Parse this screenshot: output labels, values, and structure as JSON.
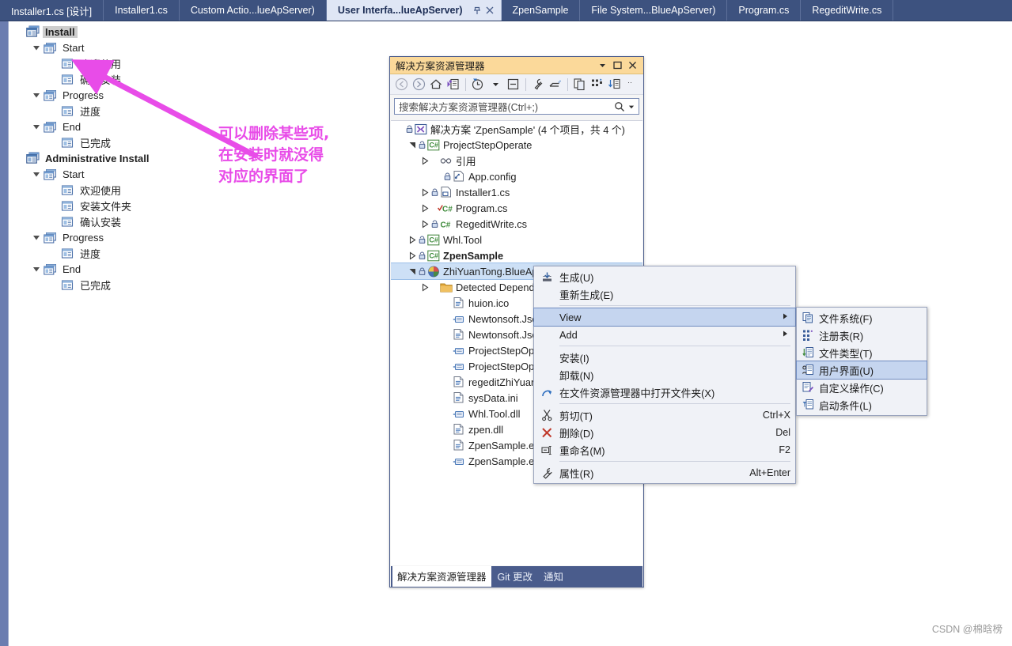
{
  "tabstrip": {
    "tabs": [
      {
        "label": "Installer1.cs [设计]",
        "active": false
      },
      {
        "label": "Installer1.cs",
        "active": false
      },
      {
        "label": "Custom Actio...lueApServer)",
        "active": false
      },
      {
        "label": "User Interfa...lueApServer)",
        "active": true
      },
      {
        "label": "ZpenSample",
        "active": false
      },
      {
        "label": "File System...BlueApServer)",
        "active": false
      },
      {
        "label": "Program.cs",
        "active": false
      },
      {
        "label": "RegeditWrite.cs",
        "active": false
      }
    ],
    "pin_icon": "pin-icon",
    "close_icon": "close-icon"
  },
  "designer": {
    "nodes": [
      {
        "label": "Install",
        "level": 0,
        "icon": "dialog-group-icon",
        "chevron": "",
        "bold": true,
        "selected": true
      },
      {
        "label": "Start",
        "level": 1,
        "icon": "dialog-stack-icon",
        "chevron": "v",
        "bold": false,
        "selected": false
      },
      {
        "label": "欢迎使用",
        "level": 2,
        "icon": "dialog-icon",
        "chevron": "",
        "bold": false,
        "selected": false
      },
      {
        "label": "确认安装",
        "level": 2,
        "icon": "dialog-icon",
        "chevron": "",
        "bold": false,
        "selected": false
      },
      {
        "label": "Progress",
        "level": 1,
        "icon": "dialog-stack-icon",
        "chevron": "v",
        "bold": false,
        "selected": false
      },
      {
        "label": "进度",
        "level": 2,
        "icon": "dialog-icon",
        "chevron": "",
        "bold": false,
        "selected": false
      },
      {
        "label": "End",
        "level": 1,
        "icon": "dialog-stack-icon",
        "chevron": "v",
        "bold": false,
        "selected": false
      },
      {
        "label": "已完成",
        "level": 2,
        "icon": "dialog-icon",
        "chevron": "",
        "bold": false,
        "selected": false
      },
      {
        "label": "Administrative Install",
        "level": 0,
        "icon": "dialog-group-icon",
        "chevron": "",
        "bold": true,
        "selected": false
      },
      {
        "label": "Start",
        "level": 1,
        "icon": "dialog-stack-icon",
        "chevron": "v",
        "bold": false,
        "selected": false
      },
      {
        "label": "欢迎使用",
        "level": 2,
        "icon": "dialog-icon",
        "chevron": "",
        "bold": false,
        "selected": false
      },
      {
        "label": "安装文件夹",
        "level": 2,
        "icon": "dialog-icon",
        "chevron": "",
        "bold": false,
        "selected": false
      },
      {
        "label": "确认安装",
        "level": 2,
        "icon": "dialog-icon",
        "chevron": "",
        "bold": false,
        "selected": false
      },
      {
        "label": "Progress",
        "level": 1,
        "icon": "dialog-stack-icon",
        "chevron": "v",
        "bold": false,
        "selected": false
      },
      {
        "label": "进度",
        "level": 2,
        "icon": "dialog-icon",
        "chevron": "",
        "bold": false,
        "selected": false
      },
      {
        "label": "End",
        "level": 1,
        "icon": "dialog-stack-icon",
        "chevron": "v",
        "bold": false,
        "selected": false
      },
      {
        "label": "已完成",
        "level": 2,
        "icon": "dialog-icon",
        "chevron": "",
        "bold": false,
        "selected": false
      }
    ]
  },
  "annotation": {
    "color": "#e84ce8",
    "lines": "可以删除某些项,\n在安装时就没得\n对应的界面了"
  },
  "solution_explorer": {
    "title": "解决方案资源管理器",
    "window_buttons": {
      "dropdown": "chevron-down-icon",
      "maximize": "maximize-icon",
      "close": "close-icon"
    },
    "toolbar": [
      "back-icon",
      "forward-icon",
      "home-icon",
      "sync-with-active-document-icon",
      "pending-changes-filter-icon",
      "filter-dropdown-icon",
      "collapse-all-icon",
      "properties-icon",
      "preview-selected-items-icon",
      "show-all-files-icon",
      "view-class-diagram-icon",
      "show-code-icon",
      "overflow-icon"
    ],
    "search": {
      "placeholder": "搜索解决方案资源管理器(Ctrl+;)",
      "value": "",
      "search_icon": "search-icon",
      "dropdown_icon": "chevron-down-icon"
    },
    "tree": [
      {
        "label": "解决方案 'ZpenSample' (4 个项目，共 4 个)",
        "level": 0,
        "expander": "",
        "lock": true,
        "icon": "solution-icon",
        "bold": false,
        "selected": false
      },
      {
        "label": "ProjectStepOperate",
        "level": 1,
        "expander": "v",
        "lock": true,
        "icon": "csharp-project-icon",
        "bold": false,
        "selected": false
      },
      {
        "label": "引用",
        "level": 2,
        "expander": ">",
        "lock": false,
        "icon": "references-icon",
        "bold": false,
        "selected": false
      },
      {
        "label": "App.config",
        "level": 3,
        "expander": "",
        "lock": true,
        "icon": "config-file-icon",
        "bold": false,
        "selected": false
      },
      {
        "label": "Installer1.cs",
        "level": 2,
        "expander": ">",
        "lock": true,
        "icon": "component-file-icon",
        "bold": false,
        "selected": false
      },
      {
        "label": "Program.cs",
        "level": 2,
        "expander": ">",
        "lock": false,
        "icon": "csharp-file-checked-icon",
        "bold": false,
        "selected": false
      },
      {
        "label": "RegeditWrite.cs",
        "level": 2,
        "expander": ">",
        "lock": true,
        "icon": "csharp-file-icon",
        "bold": false,
        "selected": false
      },
      {
        "label": "Whl.Tool",
        "level": 1,
        "expander": ">",
        "lock": true,
        "icon": "csharp-project-icon",
        "bold": false,
        "selected": false
      },
      {
        "label": "ZpenSample",
        "level": 1,
        "expander": ">",
        "lock": true,
        "icon": "csharp-project-icon",
        "bold": true,
        "selected": false
      },
      {
        "label": "ZhiYuanTong.BlueApServer",
        "level": 1,
        "expander": "v",
        "lock": true,
        "icon": "setup-project-icon",
        "bold": false,
        "selected": true
      },
      {
        "label": "Detected Dependencies",
        "level": 2,
        "expander": ">",
        "lock": false,
        "icon": "folder-icon",
        "bold": false,
        "selected": false
      },
      {
        "label": "huion.ico",
        "level": 3,
        "expander": "",
        "lock": false,
        "icon": "file-icon",
        "bold": false,
        "selected": false
      },
      {
        "label": "Newtonsoft.Json.dll",
        "level": 3,
        "expander": "",
        "lock": false,
        "icon": "assembly-icon",
        "bold": false,
        "selected": false
      },
      {
        "label": "Newtonsoft.Json.xml",
        "level": 3,
        "expander": "",
        "lock": false,
        "icon": "file-icon",
        "bold": false,
        "selected": false
      },
      {
        "label": "ProjectStepOperate.exe",
        "level": 3,
        "expander": "",
        "lock": false,
        "icon": "assembly-icon",
        "bold": false,
        "selected": false
      },
      {
        "label": "ProjectStepOperate.exe.config",
        "level": 3,
        "expander": "",
        "lock": false,
        "icon": "assembly-icon",
        "bold": false,
        "selected": false
      },
      {
        "label": "regeditZhiYuanTong.reg",
        "level": 3,
        "expander": "",
        "lock": false,
        "icon": "file-icon",
        "bold": false,
        "selected": false
      },
      {
        "label": "sysData.ini",
        "level": 3,
        "expander": "",
        "lock": false,
        "icon": "file-icon",
        "bold": false,
        "selected": false
      },
      {
        "label": "Whl.Tool.dll",
        "level": 3,
        "expander": "",
        "lock": false,
        "icon": "assembly-icon",
        "bold": false,
        "selected": false
      },
      {
        "label": "zpen.dll",
        "level": 3,
        "expander": "",
        "lock": false,
        "icon": "file-icon",
        "bold": false,
        "selected": false
      },
      {
        "label": "ZpenSample.exe.config",
        "level": 3,
        "expander": "",
        "lock": false,
        "icon": "file-icon",
        "bold": false,
        "selected": false
      },
      {
        "label": "ZpenSample.exe",
        "level": 3,
        "expander": "",
        "lock": false,
        "icon": "assembly-icon",
        "bold": false,
        "selected": false
      }
    ],
    "bottom_tabs": [
      {
        "label": "解决方案资源管理器",
        "active": true
      },
      {
        "label": "Git 更改",
        "active": false
      },
      {
        "label": "通知",
        "active": false
      }
    ]
  },
  "context_menu": {
    "items": [
      {
        "type": "item",
        "label": "生成(U)",
        "icon": "build-icon",
        "shortcut": "",
        "submenu": false,
        "highlighted": false
      },
      {
        "type": "item",
        "label": "重新生成(E)",
        "icon": "",
        "shortcut": "",
        "submenu": false,
        "highlighted": false
      },
      {
        "type": "sep"
      },
      {
        "type": "item",
        "label": "View",
        "icon": "",
        "shortcut": "",
        "submenu": true,
        "highlighted": true
      },
      {
        "type": "item",
        "label": "Add",
        "icon": "",
        "shortcut": "",
        "submenu": true,
        "highlighted": false
      },
      {
        "type": "sep"
      },
      {
        "type": "item",
        "label": "安装(I)",
        "icon": "",
        "shortcut": "",
        "submenu": false,
        "highlighted": false
      },
      {
        "type": "item",
        "label": "卸载(N)",
        "icon": "",
        "shortcut": "",
        "submenu": false,
        "highlighted": false
      },
      {
        "type": "item",
        "label": "在文件资源管理器中打开文件夹(X)",
        "icon": "open-folder-arrow-icon",
        "shortcut": "",
        "submenu": false,
        "highlighted": false
      },
      {
        "type": "sep"
      },
      {
        "type": "item",
        "label": "剪切(T)",
        "icon": "cut-icon",
        "shortcut": "Ctrl+X",
        "submenu": false,
        "highlighted": false
      },
      {
        "type": "item",
        "label": "删除(D)",
        "icon": "delete-x-icon",
        "shortcut": "Del",
        "submenu": false,
        "highlighted": false
      },
      {
        "type": "item",
        "label": "重命名(M)",
        "icon": "rename-icon",
        "shortcut": "F2",
        "submenu": false,
        "highlighted": false
      },
      {
        "type": "sep"
      },
      {
        "type": "item",
        "label": "属性(R)",
        "icon": "wrench-icon",
        "shortcut": "Alt+Enter",
        "submenu": false,
        "highlighted": false
      }
    ]
  },
  "submenu": {
    "items": [
      {
        "label": "文件系统(F)",
        "icon": "file-system-icon",
        "highlighted": false
      },
      {
        "label": "注册表(R)",
        "icon": "registry-icon",
        "highlighted": false
      },
      {
        "label": "文件类型(T)",
        "icon": "file-types-icon",
        "highlighted": false
      },
      {
        "label": "用户界面(U)",
        "icon": "user-interface-icon",
        "highlighted": true
      },
      {
        "label": "自定义操作(C)",
        "icon": "custom-actions-icon",
        "highlighted": false
      },
      {
        "label": "启动条件(L)",
        "icon": "launch-conditions-icon",
        "highlighted": false
      }
    ]
  },
  "watermark": {
    "text": "CSDN @棉晗榜"
  }
}
